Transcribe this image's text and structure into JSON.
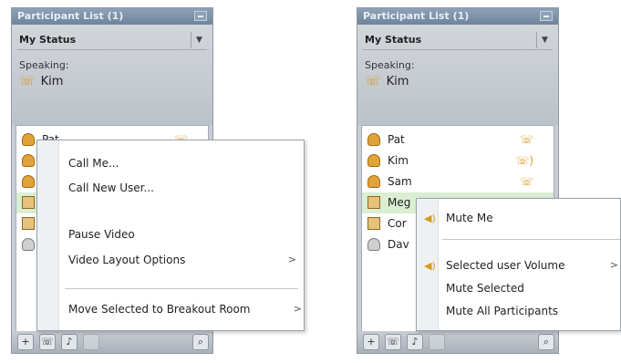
{
  "left_panel": {
    "title": "Participant List (1)",
    "my_status_label": "My Status",
    "speaking_label": "Speaking:",
    "speaker_name": "Kim",
    "participants": [
      {
        "name": "Pat",
        "avatar": "person-icon",
        "status_icon": "phone-video-icon"
      },
      {
        "name": "",
        "avatar": "person-icon",
        "status_icon": ""
      },
      {
        "name": "",
        "avatar": "person-icon",
        "status_icon": ""
      },
      {
        "name": "",
        "avatar": "video-camera-icon",
        "status_icon": ""
      },
      {
        "name": "",
        "avatar": "video-camera-icon",
        "status_icon": ""
      },
      {
        "name": "",
        "avatar": "grey-person-icon",
        "status_icon": ""
      }
    ],
    "context_menu": {
      "items": [
        "Call Me...",
        "Call New User...",
        "Pause Video",
        "Video Layout Options",
        "Move Selected to Breakout Room"
      ]
    }
  },
  "right_panel": {
    "title": "Participant List (1)",
    "my_status_label": "My Status",
    "speaking_label": "Speaking:",
    "speaker_name": "Kim",
    "participants": [
      {
        "name": "Pat",
        "avatar": "person-icon",
        "status_icon": "phone-video-icon"
      },
      {
        "name": "Kim",
        "avatar": "person-icon",
        "status_icon": "phone-speaking-icon"
      },
      {
        "name": "Sam",
        "avatar": "person-icon",
        "status_icon": "phone-video-icon"
      },
      {
        "name": "Meg",
        "avatar": "video-camera-icon",
        "status_icon": ""
      },
      {
        "name": "Cor",
        "avatar": "video-camera-icon",
        "status_icon": ""
      },
      {
        "name": "Dav",
        "avatar": "grey-person-icon",
        "status_icon": ""
      }
    ],
    "context_menu": {
      "items": [
        "Mute Me",
        "Selected user Volume",
        "Mute Selected",
        "Mute All Participants"
      ]
    }
  },
  "colors": {
    "title_bar": "#6e849c",
    "selected_row": "#d9eed2",
    "phone_icon": "#d89a1e"
  }
}
